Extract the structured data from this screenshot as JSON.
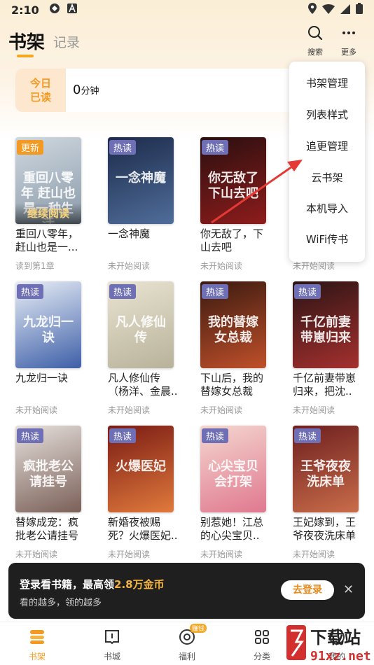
{
  "status_bar": {
    "time": "2:10"
  },
  "header": {
    "tab_shelf": "书架",
    "tab_record": "记录",
    "search_label": "搜索",
    "more_label": "更多"
  },
  "today": {
    "label_line1": "今日",
    "label_line2": "已读",
    "value": "0",
    "unit": "分钟"
  },
  "books": [
    {
      "title": "重回八零年，赶山也是一...",
      "status": "读到第1章",
      "badge": "更新",
      "cover_text": "重回八零年 赶山也是一种生活",
      "action": "继续阅读"
    },
    {
      "title": "一念神魔",
      "status": "未开始阅读",
      "badge": "热读",
      "cover_text": "一念神魔"
    },
    {
      "title": "你无敌了，下山去吧",
      "status": "未开始阅读",
      "badge": "热读",
      "cover_text": "你无敌了下山去吧"
    },
    {
      "title": "",
      "status": "未开始阅读",
      "badge": "",
      "cover_text": ""
    },
    {
      "title": "九龙归一诀",
      "status": "未开始阅读",
      "badge": "热读",
      "cover_text": "九龙归一诀"
    },
    {
      "title": "凡人修仙传（杨洋、金晨..",
      "status": "未开始阅读",
      "badge": "热读",
      "cover_text": "凡人修仙传"
    },
    {
      "title": "下山后，我的替嫁女总裁",
      "status": "未开始阅读",
      "badge": "热读",
      "cover_text": "我的替嫁女总裁"
    },
    {
      "title": "千亿前妻带崽归来，把沈..",
      "status": "未开始阅读",
      "badge": "热读",
      "cover_text": "千亿前妻带崽归来"
    },
    {
      "title": "替嫁成宠：疯批老公请挂号",
      "status": "未开始阅读",
      "badge": "热读",
      "cover_text": "疯批老公请挂号"
    },
    {
      "title": "新婚夜被赐死？火爆医妃..",
      "status": "未开始阅读",
      "badge": "热读",
      "cover_text": "火爆医妃"
    },
    {
      "title": "别惹她！江总的心尖宝贝..",
      "status": "未开始阅读",
      "badge": "热读",
      "cover_text": "心尖宝贝会打架"
    },
    {
      "title": "王妃嫁到，王爷夜夜洗床单",
      "status": "未开始阅读",
      "badge": "热读",
      "cover_text": "王爷夜夜洗床单"
    }
  ],
  "menu": [
    "书架管理",
    "列表样式",
    "追更管理",
    "云书架",
    "本机导入",
    "WiFi传书"
  ],
  "toast": {
    "title_prefix": "登录看书籍，最高领",
    "title_highlight": "2.8万金币",
    "subtitle": "看的越多，领的越多",
    "button": "去登录"
  },
  "nav": [
    {
      "label": "书架"
    },
    {
      "label": "书城"
    },
    {
      "label": "福利",
      "badge": "赚钱"
    },
    {
      "label": "分类"
    },
    {
      "label": "我的"
    }
  ],
  "watermark": {
    "main": "下载站",
    "sub": "91xz.net"
  },
  "colors": {
    "accent": "#f39a23",
    "badge": "#6e6fb4"
  }
}
